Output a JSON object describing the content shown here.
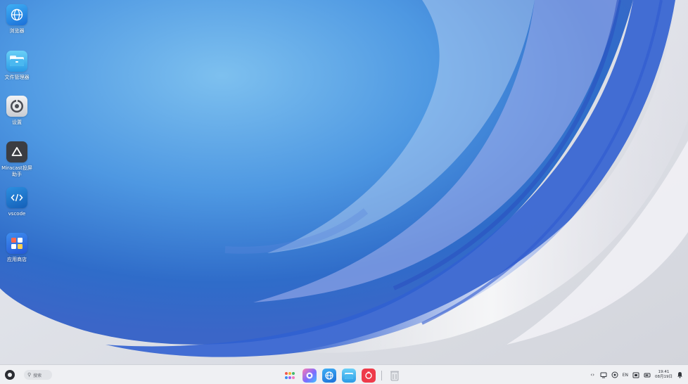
{
  "desktop": {
    "icons": [
      {
        "label": "浏览器",
        "icon": "globe-icon"
      },
      {
        "label": "文件管理器",
        "icon": "folder-icon"
      },
      {
        "label": "设置",
        "icon": "gear-icon"
      },
      {
        "label": "Miracast投屏助手",
        "icon": "cast-icon"
      },
      {
        "label": "vscode",
        "icon": "code-icon"
      },
      {
        "label": "应用商店",
        "icon": "app-store-icon"
      }
    ]
  },
  "taskbar": {
    "search_placeholder": "搜索",
    "dock": [
      "launcher-icon",
      "paint-icon",
      "browser-icon",
      "files-icon",
      "recorder-icon",
      "trash-icon"
    ],
    "tray": {
      "input_method": "EN",
      "time": "19:41",
      "date": "08月19日"
    }
  },
  "colors": {
    "wallpaper_blue": "#3a7fd6",
    "taskbar_bg": "#f0f1f4",
    "accent": "#2f8cf0"
  }
}
